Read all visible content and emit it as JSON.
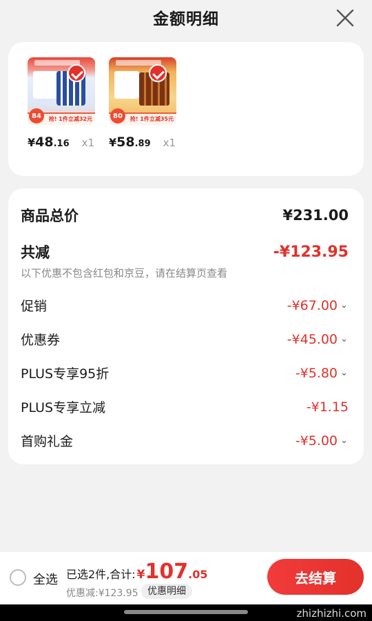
{
  "header": {
    "title": "金额明细"
  },
  "products": [
    {
      "price_yuan": "¥",
      "price_int": "48",
      "price_dec": ".16",
      "qty": "x1",
      "badge_num": "84",
      "save_text": "抢! 1件立减32元"
    },
    {
      "price_yuan": "¥",
      "price_int": "58",
      "price_dec": ".89",
      "qty": "x1",
      "badge_num": "80",
      "save_text": "抢! 1件立减35元"
    }
  ],
  "details": {
    "total_label": "商品总价",
    "total_value": "¥231.00",
    "reduce_label": "共减",
    "reduce_value": "-¥123.95",
    "note": "以下优惠不包含红包和京豆，请在结算页查看",
    "items": [
      {
        "label": "促销",
        "value": "-¥67.00"
      },
      {
        "label": "优惠券",
        "value": "-¥45.00"
      },
      {
        "label": "PLUS专享95折",
        "value": "-¥5.80"
      },
      {
        "label": "PLUS专享立减",
        "value": "-¥1.15"
      },
      {
        "label": "首购礼金",
        "value": "-¥5.00"
      }
    ]
  },
  "footer": {
    "select_all": "全选",
    "selected": "已选2件,合计:",
    "total_yuan": "¥",
    "total_int": "107",
    "total_dec": ".05",
    "discount": "优惠减:¥123.95",
    "detail_btn": "优惠明细",
    "checkout": "去结算"
  },
  "watermark": "zhizhizhi.com"
}
